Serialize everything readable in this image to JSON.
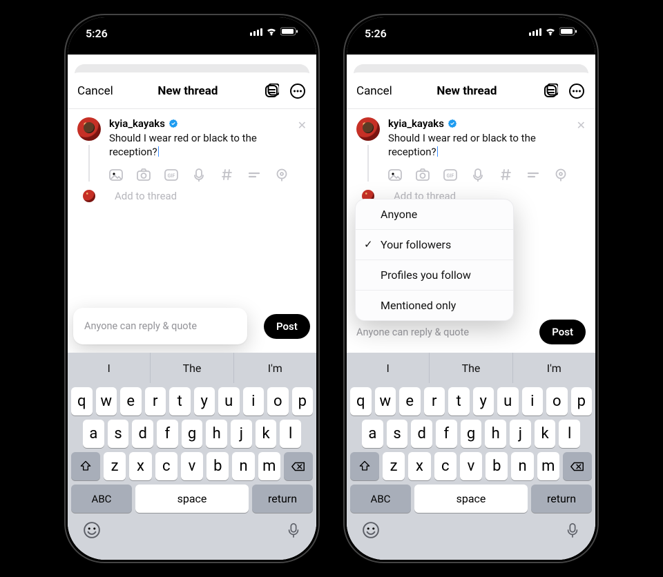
{
  "status": {
    "time": "5:26"
  },
  "topbar": {
    "cancel": "Cancel",
    "title": "New thread"
  },
  "compose": {
    "username": "kyia_kayaks",
    "text": "Should I wear red or black to the reception?",
    "add_to_thread": "Add to thread"
  },
  "bottom": {
    "reply_label": "Anyone can reply & quote",
    "post": "Post"
  },
  "menu": {
    "items": [
      "Anyone",
      "Your followers",
      "Profiles you follow",
      "Mentioned only"
    ],
    "selected_index": 1
  },
  "keyboard": {
    "suggestions": [
      "I",
      "The",
      "I'm"
    ],
    "row1": [
      "q",
      "w",
      "e",
      "r",
      "t",
      "y",
      "u",
      "i",
      "o",
      "p"
    ],
    "row2": [
      "a",
      "s",
      "d",
      "f",
      "g",
      "h",
      "j",
      "k",
      "l"
    ],
    "row3": [
      "z",
      "x",
      "c",
      "v",
      "b",
      "n",
      "m"
    ],
    "abc": "ABC",
    "space": "space",
    "return": "return"
  }
}
